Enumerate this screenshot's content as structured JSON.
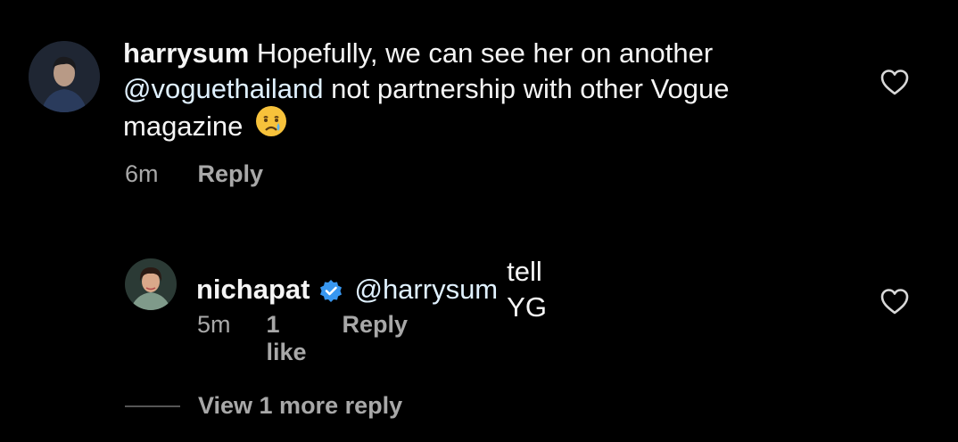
{
  "comment": {
    "username": "harrysum",
    "text_before": "Hopefully, we can see her on another",
    "mention": "@voguethailand",
    "text_after": "not partnership with other Vogue magazine",
    "emoji": "crying-face-emoji",
    "time": "6m",
    "reply_label": "Reply",
    "liked": false
  },
  "reply": {
    "username": "nichapat",
    "verified": true,
    "mention": "@harrysum",
    "text": "tell YG",
    "time": "5m",
    "likes_label": "1 like",
    "reply_label": "Reply",
    "liked": false
  },
  "view_more": {
    "label": "View 1 more reply"
  },
  "colors": {
    "background": "#000000",
    "text": "#f5f5f5",
    "meta": "#a8a8a8",
    "verified_badge": "#3897f0"
  }
}
